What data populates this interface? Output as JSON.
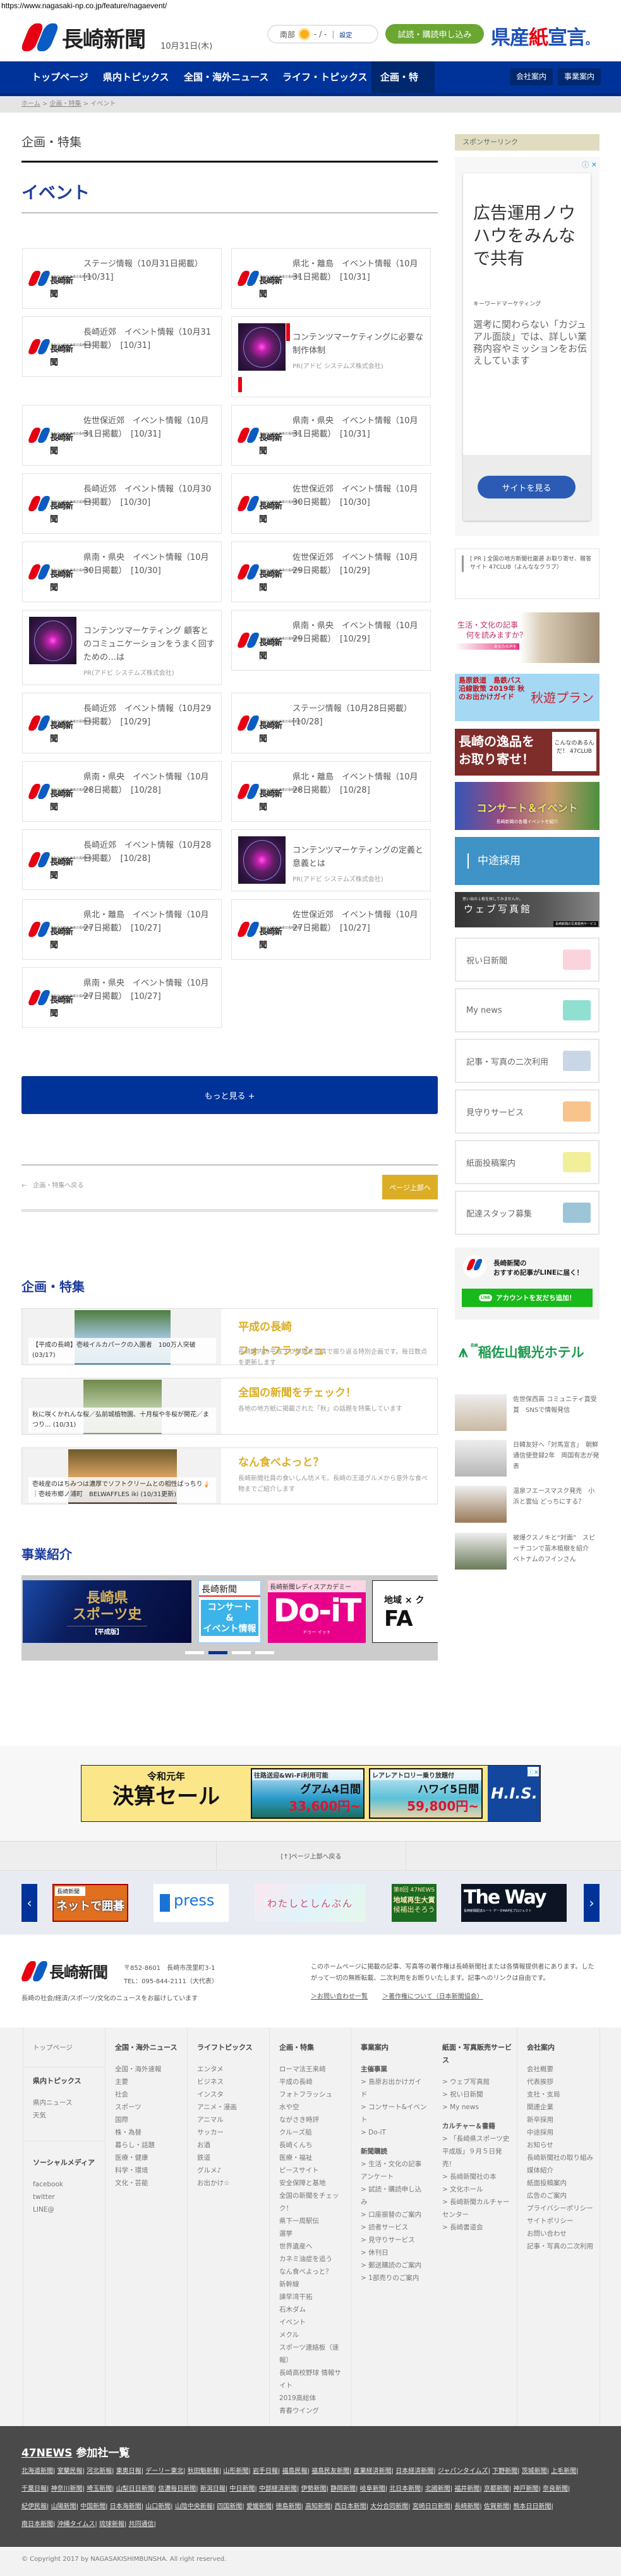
{
  "url": "https://www.nagasaki-np.co.jp/feature/nagaevent/",
  "header": {
    "logo_text": "長崎新聞",
    "date": "10月31日(木)",
    "weather": {
      "region": "南部",
      "temp": "- / -",
      "settings": "設定"
    },
    "apply_label": "試読・購読申し込み",
    "kensan": [
      "県産",
      "紙",
      "宣言",
      "。"
    ]
  },
  "nav": {
    "items": [
      "トップページ",
      "県内トピックス",
      "全国・海外ニュース",
      "ライフ・トピックス",
      "企画・特集"
    ],
    "active": "企画・特集",
    "right": [
      "会社案内",
      "事業案内"
    ]
  },
  "breadcrumb": [
    "ホーム",
    "企画・特集",
    "イベント"
  ],
  "section_label": "企画・特集",
  "page_title": "イベント",
  "events": [
    {
      "title": "ステージ情報（10月31日掲載）　[10/31]"
    },
    {
      "title": "県北・離島　イベント情報（10月31日掲載）　[10/31]"
    },
    {
      "title": "長崎近郊　イベント情報（10月31日掲載）　[10/31]"
    },
    {
      "title": "コンテンツマーケティングに必要な制作体制",
      "pr": "PR(アドビ システムズ株式会社)"
    },
    {
      "title": "佐世保近郊　イベント情報（10月31日掲載）　[10/31]"
    },
    {
      "title": "県南・県央　イベント情報（10月31日掲載）　[10/31]"
    },
    {
      "title": "長崎近郊　イベント情報（10月30日掲載）　[10/30]"
    },
    {
      "title": "佐世保近郊　イベント情報（10月30日掲載）　[10/30]"
    },
    {
      "title": "県南・県央　イベント情報（10月30日掲載）　[10/30]"
    },
    {
      "title": "佐世保近郊　イベント情報（10月29日掲載）　[10/29]"
    },
    {
      "title": "コンテンツマーケティング 顧客とのコミュニケーションをうまく回すための…は",
      "pr": "PR(アドビ システムズ株式会社)"
    },
    {
      "title": "県南・県央　イベント情報（10月29日掲載）　[10/29]"
    },
    {
      "title": "長崎近郊　イベント情報（10月29日掲載）　[10/29]"
    },
    {
      "title": "ステージ情報（10月28日掲載）　[10/28]"
    },
    {
      "title": "県南・県央　イベント情報（10月28日掲載）　[10/28]"
    },
    {
      "title": "県北・離島　イベント情報（10月28日掲載）　[10/28]"
    },
    {
      "title": "長崎近郊　イベント情報（10月28日掲載）　[10/28]"
    },
    {
      "title": "コンテンツマーケティングの定義と意義とは",
      "pr": "PR(アドビ システムズ株式会社)"
    },
    {
      "title": "県北・離島　イベント情報（10月27日掲載）　[10/27]"
    },
    {
      "title": "佐世保近郊　イベント情報（10月27日掲載）　[10/27]"
    },
    {
      "title": "県南・県央　イベント情報（10月27日掲載）　[10/27]"
    }
  ],
  "logo_small_caption": "あなたと創る未来の長崎新聞",
  "more_label": "もっと見る +",
  "back_label": "←　企画・特集へ戻る",
  "page_top_label": "ページ上部へ",
  "features": {
    "heading": "企画・特集",
    "items": [
      {
        "caption": "【平成の長崎】壱岐イルカパークの入園者　100万人突破 (03/17)",
        "title": "平成の長崎\nフォトフラッシュ",
        "desc": "長崎県内の平成３０年間を写真で振り返る特別企画です。毎日数点を更新します"
      },
      {
        "caption": "秋に咲くかれんな桜／弘前城植物園、十月桜や冬桜が開花／まつり... (10/31)",
        "title": "全国の新聞をチェック！",
        "desc": "各地の地方紙に掲載された「秋」の話題を特集しています"
      },
      {
        "caption": "壱岐産のはちみつは濃厚でソフトクリームとの相性ばっちり🍦｜壱岐市郷ノ浦町　BELWAFFLES iki (10/31更新)",
        "title": "なん食べよっと？",
        "desc": "長崎新聞社員の食いしん坊メモ。長崎の王道グルメから意外な食べ物までご紹介します"
      }
    ]
  },
  "business": {
    "heading": "事業紹介",
    "slides": [
      {
        "line1": "長崎県",
        "line2": "スポーツ史",
        "line3": "【平成版】"
      },
      {
        "logo": "長崎新聞",
        "line1": "コンサート",
        "line2": "&",
        "line3": "イベント情報"
      },
      {
        "line1": "長崎新聞レディスアカデミー",
        "line2": "Do-iT",
        "line3": "ドゥー イット"
      },
      {
        "line1": "地域 × ク",
        "line2": "FA"
      }
    ],
    "active_slide": 2,
    "slide_count": 4
  },
  "his_ad": {
    "era": "令和元年",
    "sale": "決算セール",
    "p1": {
      "head": "往路送迎&Wi-Fi利用可能",
      "dest": "グアム4日間",
      "price": "33,600円~"
    },
    "p2": {
      "head": "レアレアトロリー乗り放題付",
      "dest": "ハワイ5日間",
      "price": "59,800円~"
    },
    "brand": "H.I.S."
  },
  "back_to_top": "[↑]ページ上部へ戻る",
  "partners": [
    {
      "top": "長崎新聞",
      "main": "ネットで囲碁"
    },
    {
      "main": "press"
    },
    {
      "main": "わたしとしんぶん"
    },
    {
      "top": "第8回 47NEWS",
      "main": "地域再生大賞",
      "bottom": "候補出そろう"
    },
    {
      "main": "The Way",
      "bottom": "長崎新聞配達ルート データMAP化プロジェクト"
    }
  ],
  "sidebar": {
    "sponsor_label": "スポンサーリンク",
    "ad": {
      "headline": "広告運用ノウハウをみんなで共有",
      "advertiser": "キーワードマーケティング",
      "body": "選考に関わらない「カジュアル面談」では、詳しい業務内容やミッションをお伝えしています",
      "cta": "サイトを見る"
    },
    "pr_text": "[ PR ] 全国の地方新聞社厳選 お取り寄せ、贈答サイト 47CLUB（よんななクラブ）",
    "banners": [
      {
        "l1": "生活・文化の記事",
        "l2": "何を読みますか？",
        "l3": "あなたの声を"
      },
      {
        "l1": "島原鉄道　島鉄バス",
        "l2": "沿線散策 2019年 秋のお出かけガイド",
        "l3": "秋遊プラン"
      },
      {
        "l1": "長崎の逸品を",
        "l2": "お取り寄せ！",
        "l3": "こんなのあるんだ！ 47CLUB"
      },
      {
        "l1": "コンサート＆イベント",
        "l2": "長崎新聞の各種イベントを紹介"
      },
      {
        "l1": "中途採用"
      },
      {
        "l1": "思い出の１枚を探してみませんか。",
        "l2": "ウェブ写真館",
        "l3": "長崎新聞の写真販売サービス"
      }
    ],
    "services": [
      "祝い日新聞",
      "My news",
      "記事・写真の二次利用",
      "見守りサービス",
      "紙面投稿案内",
      "配達スタッフ募集"
    ],
    "service_colors": [
      "#fbd3dd",
      "#8fe0d1",
      "#c9d6e6",
      "#f9c48c",
      "#f1ef9a",
      "#9cc6d8"
    ],
    "line": {
      "title": "長崎新聞の\nおすすめ記事がLINEに届く！",
      "button": "アカウントを友だち追加！",
      "icon": "LINE"
    },
    "hotel": {
      "small": "長崎",
      "name": "稲佐山観光ホテル"
    },
    "news": [
      "佐世保西高 コミュニティ賞受賞　SNSで情報発信",
      "日韓友好へ「対馬宣言」　朝鮮通信使登録2年　両国有志が発表",
      "温泉フエースマスク発売　小浜と雲仙 どっちにする？",
      "被爆クスノキと“対面”　スピーチコンで苗木植樹を紹介　ベトナムのフインさん"
    ]
  },
  "footer": {
    "address": "〒852-8601　長崎市茂里町3-1",
    "tel": "TEL：095-844-2111（大代表）",
    "tagline": "長崎の社会/経済/スポーツ/文化のニュースをお届けしています",
    "notice": "このホームページに掲載の記事、写真等の著作権は長崎新聞社または各情報提供者にあります。したがって一切の無断転載、二次利用をお断りいたします。記事へのリンクは自由です。",
    "links": [
      "＞お問い合わせ一覧",
      "＞著作権について（日本新聞協会）"
    ],
    "col1": {
      "top": "トップページ",
      "sections": [
        {
          "heading": "県内トピックス",
          "items": [
            "県内ニュース",
            "天気"
          ]
        },
        {
          "heading": "ソーシャルメディア",
          "items": [
            "facebook",
            "twitter",
            "LINE@"
          ]
        }
      ]
    },
    "columns": [
      {
        "heading": "全国・海外ニュース",
        "items": [
          "全国・海外速報",
          "主要",
          "社会",
          "スポーツ",
          "国際",
          "株・為替",
          "暮らし・話題",
          "医療・健康",
          "科学・環境",
          "文化・芸能"
        ]
      },
      {
        "heading": "ライフトピックス",
        "items": [
          "エンタメ",
          "ビジネス",
          "インスタ",
          "アニメ・漫画",
          "アニマル",
          "サッカー",
          "お酒",
          "鉄道",
          "グルメ♪",
          "お出かけ☆"
        ]
      },
      {
        "heading": "企画・特集",
        "items": [
          "ローマ法王来崎",
          "平成の長崎",
          "フォトフラッシュ",
          "水や空",
          "ながさき時評",
          "クルーズ船",
          "長崎くんち",
          "医療・福祉",
          "ピースサイト",
          "安全保障と基地",
          "全国の新聞をチェック！",
          "県下一周駅伝",
          "選挙",
          "世界遺産へ",
          "カネミ油症を追う",
          "なん食べよっと？",
          "新幹線",
          "諫早湾干拓",
          "石木ダム",
          "イベント",
          "メクル",
          "スポーツ連絡板（速報）",
          "長崎高校野球 情報サイト",
          "2019高総体",
          "青春ウイング"
        ]
      },
      {
        "heading": "事業案内",
        "items": [
          {
            "t": "主催事業",
            "sub": true
          },
          "> 島原お出かけガイド",
          "> コンサート&イベント",
          "> Do-iT",
          {
            "t": "新聞購読",
            "sub": true
          },
          "> 生活・文化の記事アンケート",
          "> 試読・購読申し込み",
          "> 口座振替のご案内",
          "> 読者サービス",
          "> 見守りサービス",
          "> 休刊日",
          "> 郵送購読のご案内",
          "> 1部売りのご案内"
        ]
      },
      {
        "heading": "紙面・写真販売サービス",
        "items": [
          "> ウェブ写真館",
          "> 祝い日新聞",
          "> My news",
          {
            "t": "カルチャー＆書籍",
            "sub": true
          },
          "> 「長崎県スポーツ史 平成版」９月５日発売！",
          "> 長崎新聞社の本",
          "> 文化ホール",
          "> 長崎新聞カルチャーセンター",
          "> 長崎書道会"
        ]
      },
      {
        "heading": "会社案内",
        "items": [
          "会社概要",
          "代表挨拶",
          "支社・支局",
          "関連企業",
          "新卒採用",
          "中途採用",
          "お知らせ",
          "長崎新聞社の取り組み",
          "媒体紹介",
          "紙面投稿案内",
          "広告のご案内",
          "プライバシーポリシー",
          "サイトポリシー",
          "お問い合わせ",
          "記事・写真の二次利用"
        ]
      }
    ],
    "news47": {
      "brand": "47NEWS",
      "title": " 参加社一覧",
      "rows": [
        [
          "北海道新聞",
          "室蘭民報",
          "河北新報",
          "東奥日報",
          "デーリー東北",
          "秋田魁新報",
          "山形新聞",
          "岩手日報",
          "福島民報",
          "福島民友新聞",
          "産業経済新聞",
          "日本経済新聞",
          "ジャパンタイムズ",
          "下野新聞",
          "茨城新聞",
          "上毛新聞"
        ],
        [
          "千葉日報",
          "神奈川新聞",
          "埼玉新聞",
          "山梨日日新聞",
          "信濃毎日新聞",
          "新潟日報",
          "中日新聞",
          "中部経済新聞",
          "伊勢新聞",
          "静岡新聞",
          "岐阜新聞",
          "北日本新聞",
          "北國新聞",
          "福井新聞",
          "京都新聞",
          "神戸新聞",
          "奈良新聞"
        ],
        [
          "紀伊民報",
          "山陽新聞",
          "中国新聞",
          "日本海新聞",
          "山口新聞",
          "山陰中央新報",
          "四国新聞",
          "愛媛新聞",
          "徳島新聞",
          "高知新聞",
          "西日本新聞",
          "大分合同新聞",
          "宮崎日日新聞",
          "長崎新聞",
          "佐賀新聞",
          "熊本日日新聞"
        ],
        [
          "南日本新聞",
          "沖縄タイムス",
          "琉球新報",
          "共同通信"
        ]
      ]
    },
    "copyright": "© Copyright 2017 by NAGASAKISHIMBUNSHA. All right reserved."
  }
}
